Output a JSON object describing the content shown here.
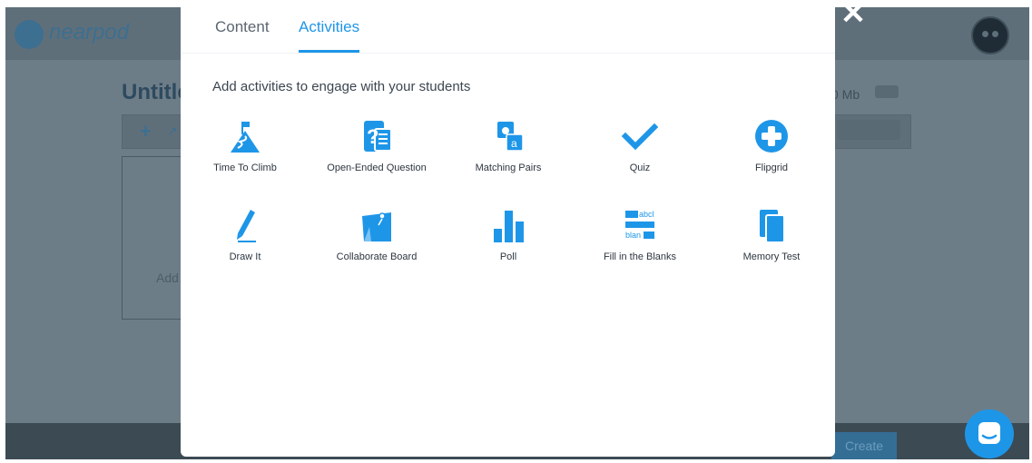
{
  "background_app": {
    "logo_text": "nearpod",
    "title": "Untitle",
    "size_text": "0 Mb",
    "add_text": "Add",
    "create_label": "Create"
  },
  "modal": {
    "tabs": [
      {
        "label": "Content",
        "active": false
      },
      {
        "label": "Activities",
        "active": true
      }
    ],
    "subtitle": "Add activities to engage with your students",
    "activities": [
      {
        "label": "Time To Climb",
        "icon": "mountain-flag-icon"
      },
      {
        "label": "Open-Ended Question",
        "icon": "question-document-icon"
      },
      {
        "label": "Matching Pairs",
        "icon": "matching-cards-icon"
      },
      {
        "label": "Quiz",
        "icon": "checkmark-icon"
      },
      {
        "label": "Flipgrid",
        "icon": "plus-circle-icon"
      },
      {
        "label": "Draw It",
        "icon": "pencil-icon"
      },
      {
        "label": "Collaborate Board",
        "icon": "board-pin-icon"
      },
      {
        "label": "Poll",
        "icon": "bar-chart-icon"
      },
      {
        "label": "Fill in the Blanks",
        "icon": "blanks-text-icon",
        "icon_text_top": "abcl",
        "icon_text_bottom": "blan"
      },
      {
        "label": "Memory Test",
        "icon": "memory-cards-icon"
      }
    ]
  },
  "colors": {
    "accent": "#1e96e8",
    "overlay": "#6d7d88",
    "text_dark": "#2e3640"
  }
}
